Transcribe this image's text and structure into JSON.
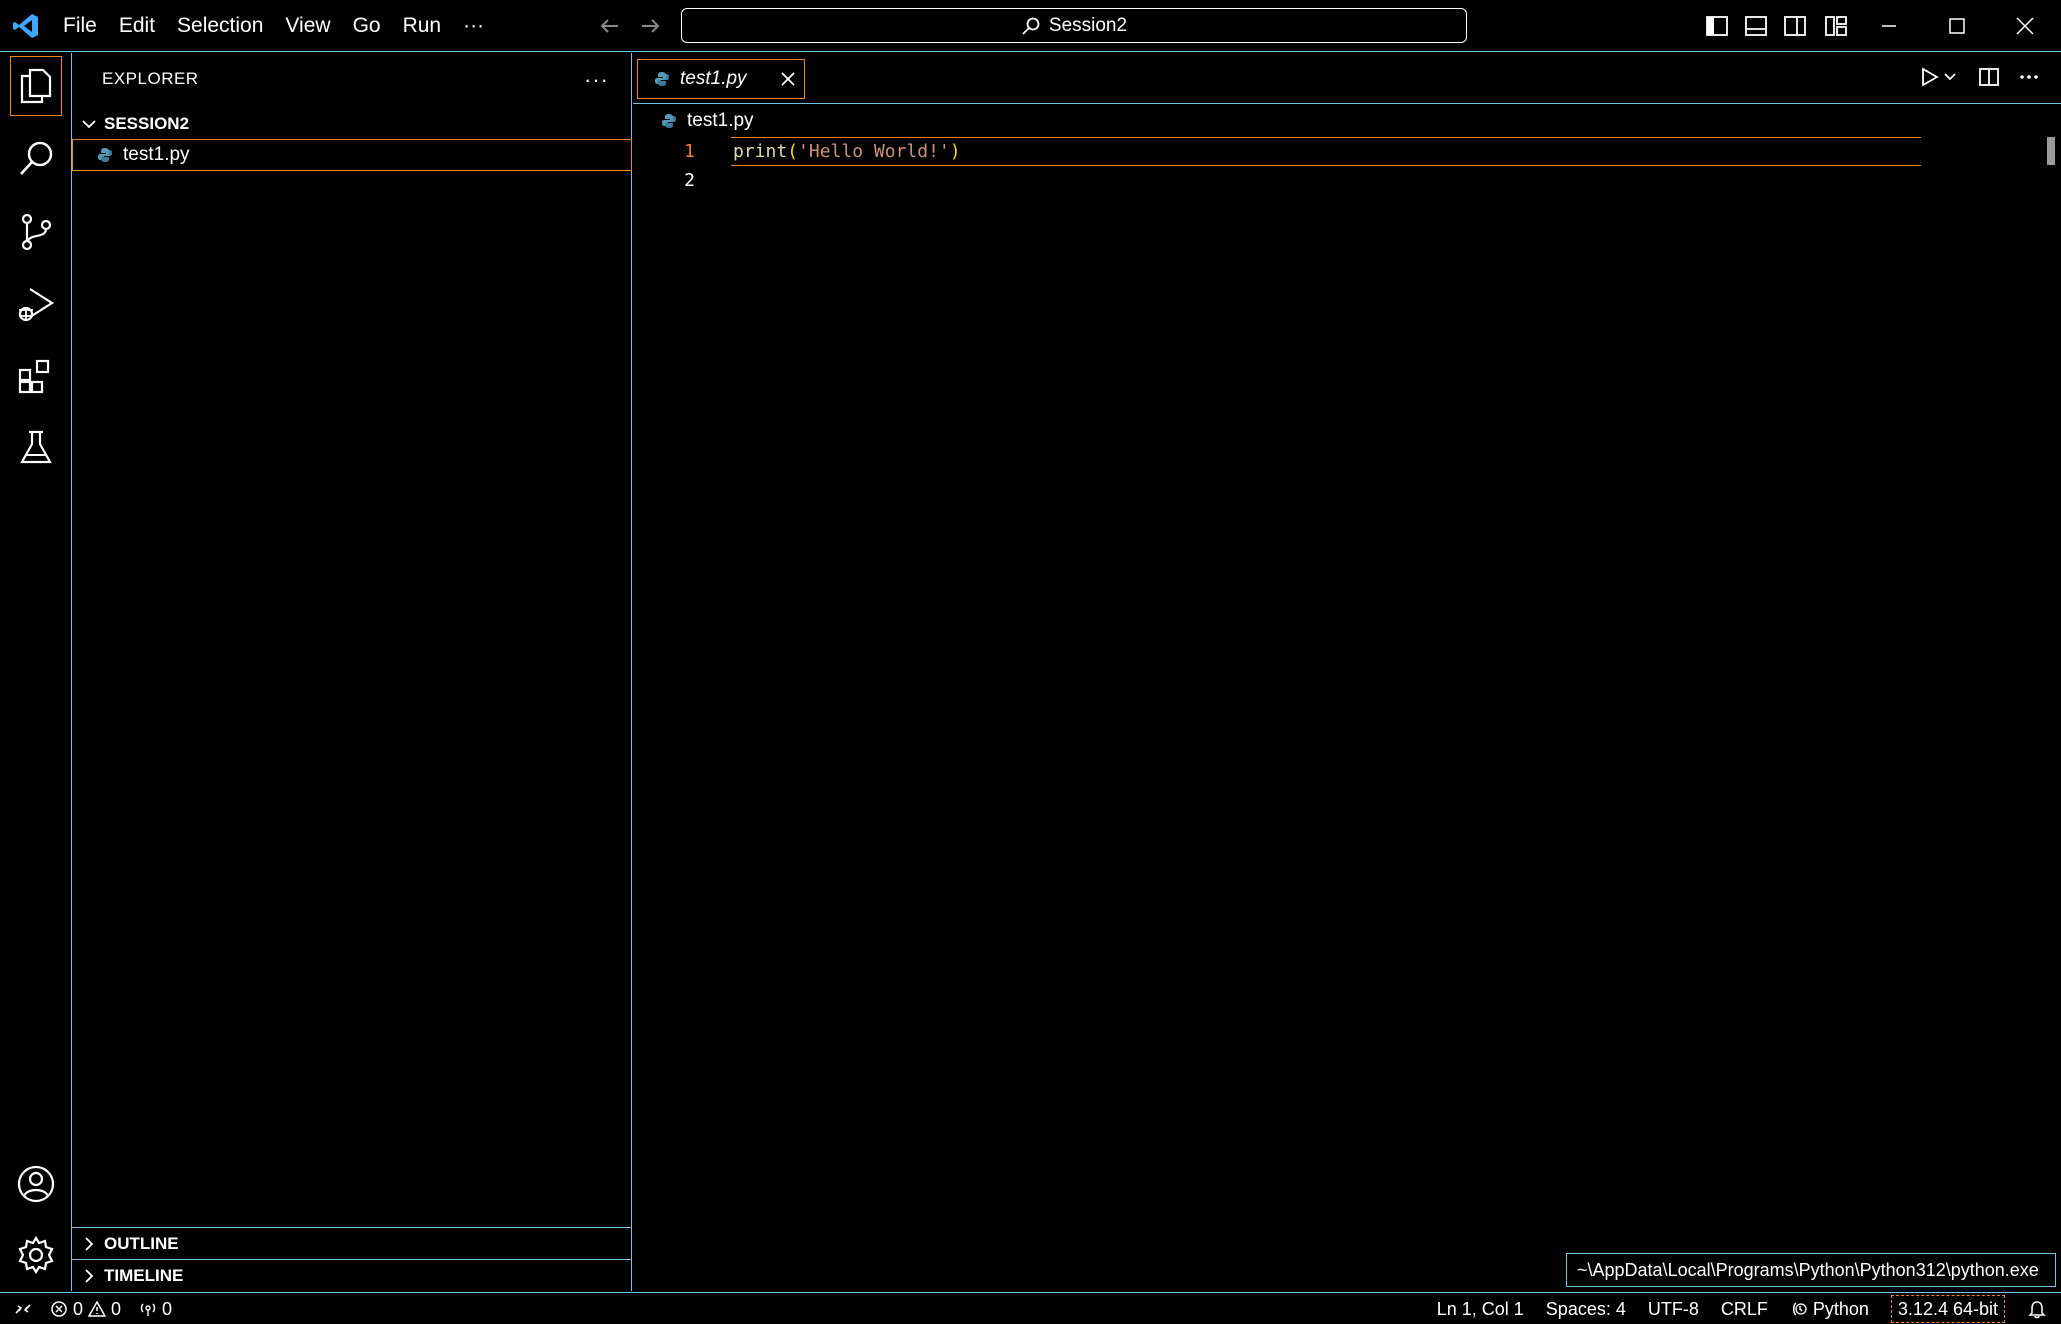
{
  "titlebar": {
    "menu": [
      "File",
      "Edit",
      "Selection",
      "View",
      "Go",
      "Run"
    ],
    "more_label": "···",
    "search_text": "Session2"
  },
  "sidebar": {
    "header": "EXPLORER",
    "more_label": "···",
    "folder_name": "SESSION2",
    "files": [
      "test1.py"
    ],
    "outline_label": "OUTLINE",
    "timeline_label": "TIMELINE"
  },
  "editor": {
    "tab_label": "test1.py",
    "breadcrumb": "test1.py",
    "line_numbers": [
      "1",
      "2"
    ],
    "code_line1": {
      "fn": "print",
      "open_paren": "(",
      "str": "'Hello World!'",
      "close_paren": ")"
    }
  },
  "tooltip": {
    "text": "~\\AppData\\Local\\Programs\\Python\\Python312\\python.exe"
  },
  "statusbar": {
    "errors": "0",
    "warnings": "0",
    "ports": "0",
    "position": "Ln 1, Col 1",
    "spaces": "Spaces: 4",
    "encoding": "UTF-8",
    "eol": "CRLF",
    "language": "Python",
    "interpreter": "3.12.4 64-bit"
  },
  "colors": {
    "border": "#6fc3df",
    "active_outline": "#f38518",
    "string": "#ce9178",
    "function": "#dcdcaa",
    "bracket": "#ffd700",
    "python_icon": "#519aba"
  }
}
